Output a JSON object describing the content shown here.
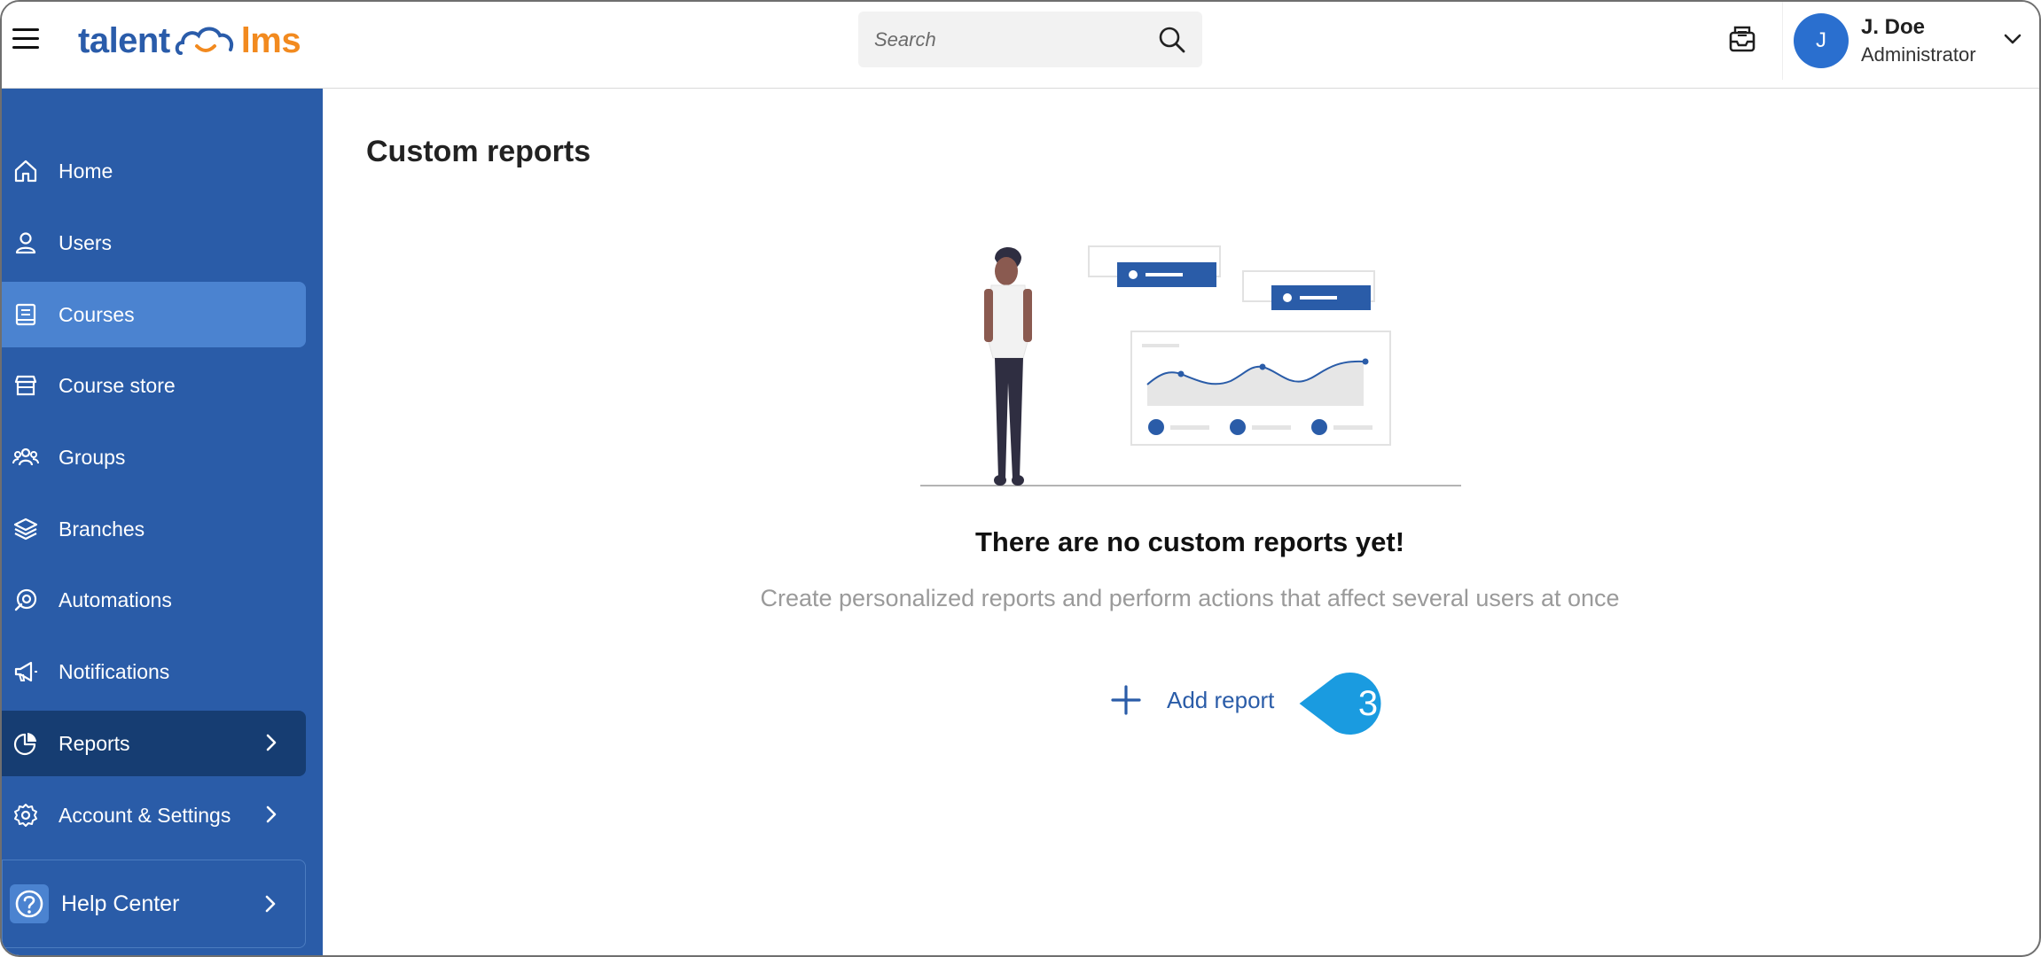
{
  "brand": {
    "part1": "talent",
    "part2": "lms",
    "primary_color": "#2a5caa",
    "accent_color": "#f28a1f"
  },
  "header": {
    "search_placeholder": "Search",
    "user": {
      "initial": "J",
      "name": "J. Doe",
      "role": "Administrator"
    }
  },
  "sidebar": {
    "items": [
      {
        "label": "Home",
        "icon": "home-icon"
      },
      {
        "label": "Users",
        "icon": "user-icon"
      },
      {
        "label": "Courses",
        "icon": "book-icon",
        "state": "highlighted"
      },
      {
        "label": "Course store",
        "icon": "store-icon"
      },
      {
        "label": "Groups",
        "icon": "groups-icon"
      },
      {
        "label": "Branches",
        "icon": "layers-icon"
      },
      {
        "label": "Automations",
        "icon": "automation-icon"
      },
      {
        "label": "Notifications",
        "icon": "megaphone-icon"
      },
      {
        "label": "Reports",
        "icon": "pie-chart-icon",
        "state": "selected",
        "has_submenu": true
      },
      {
        "label": "Account & Settings",
        "icon": "gear-icon",
        "has_submenu": true
      }
    ],
    "help": {
      "label": "Help Center",
      "icon": "question-icon"
    }
  },
  "main": {
    "title": "Custom reports",
    "empty_state": {
      "title": "There are no custom reports yet!",
      "subtitle": "Create personalized reports and perform actions that affect several users at once"
    },
    "add_report_label": "Add report",
    "step_callout": "3",
    "callout_color": "#1a9be0"
  }
}
